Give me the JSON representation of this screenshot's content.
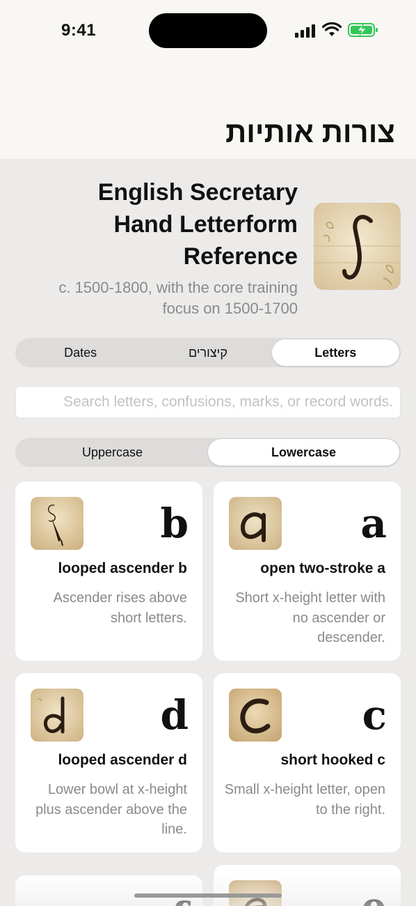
{
  "status": {
    "time": "9:41"
  },
  "nav": {
    "title": "צורות אותיות"
  },
  "reference": {
    "title": "English Secretary Hand Letterform Reference",
    "subtitle": "c. 1500-1800, with the core training focus on 1500-1700",
    "thumb_icon": "long-s-icon"
  },
  "tabs": [
    {
      "label": "Dates",
      "active": false
    },
    {
      "label": "קיצורים",
      "active": false
    },
    {
      "label": "Letters",
      "active": true
    }
  ],
  "search": {
    "placeholder": "Search letters, confusions, marks, or record words.",
    "value": ""
  },
  "case_toggle": [
    {
      "label": "Uppercase",
      "active": false
    },
    {
      "label": "Lowercase",
      "active": true
    }
  ],
  "cards": [
    {
      "glyph": "b",
      "name": "looped ascender b",
      "desc": "Ascender rises above short letters.",
      "icon": "quill-icon"
    },
    {
      "glyph": "a",
      "name": "open two-stroke a",
      "desc": "Short x-height letter with no ascender or descender.",
      "icon": "letter-a-icon"
    },
    {
      "glyph": "d",
      "name": "looped ascender d",
      "desc": "Lower bowl at x-height plus ascender above the line.",
      "icon": "letter-d-icon"
    },
    {
      "glyph": "c",
      "name": "short hooked c",
      "desc": "Small x-height letter, open to the right.",
      "icon": "letter-c-icon"
    },
    {
      "glyph": "f",
      "name": "",
      "desc": "",
      "icon": ""
    },
    {
      "glyph": "e",
      "name": "",
      "desc": "",
      "icon": "letter-e-icon"
    }
  ],
  "colors": {
    "accent_bg": "#f8f7f4",
    "parchment": "#e8d9b8",
    "ink": "#2b1d12",
    "battery": "#34c759"
  }
}
